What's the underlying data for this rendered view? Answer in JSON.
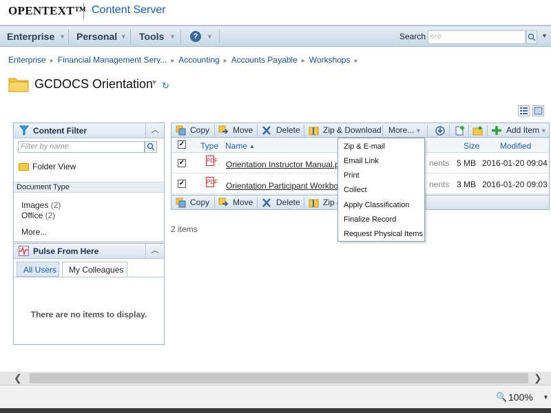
{
  "header": {
    "brand": "OPENTEXT™",
    "product": "Content Server"
  },
  "nav": {
    "items": [
      "Enterprise",
      "Personal",
      "Tools"
    ],
    "search_label": "Search",
    "search_placeholder": "ere"
  },
  "breadcrumb": [
    "Enterprise",
    "Financial Management Serv...",
    "Accounting",
    "Accounts Payable",
    "Workshops"
  ],
  "title": "GCDOCS Orientation",
  "content_filter": {
    "title": "Content Filter",
    "filter_placeholder": "Filter by name",
    "folder_view": "Folder View",
    "document_type_label": "Document Type",
    "facets": [
      {
        "label": "Images",
        "count": "(2)"
      },
      {
        "label": "Office",
        "count": "(2)"
      }
    ],
    "more": "More..."
  },
  "pulse": {
    "title": "Pulse From Here",
    "tabs": [
      "All Users",
      "My Colleagues"
    ],
    "empty": "There are no items to display."
  },
  "toolbar": {
    "copy": "Copy",
    "move": "Move",
    "delete": "Delete",
    "zip_download": "Zip & Download",
    "zip_partial": "Zip &",
    "more": "More...",
    "add_item": "Add Item"
  },
  "grid": {
    "columns": {
      "type": "Type",
      "name": "Name",
      "size": "Size",
      "modified": "Modified"
    },
    "rows": [
      {
        "name": "Orientation Instructor Manual.pdf",
        "hidden_text": "nents",
        "size": "5 MB",
        "modified": "2016-01-20 09:04"
      },
      {
        "name": "Orientation Participant Workbook",
        "hidden_text": "nents",
        "size": "3 MB",
        "modified": "2016-01-20 09:03"
      }
    ],
    "count": "2 items"
  },
  "more_menu": [
    "Zip & E-mail",
    "Email Link",
    "Print",
    "Collect",
    "Apply Classification",
    "Finalize Record",
    "Request Physical Items"
  ],
  "status": {
    "zoom": "100%"
  },
  "colors": {
    "accent": "#1a5ea8",
    "nav_bg": "#d6e1ed",
    "folder": "#f2c94c"
  }
}
